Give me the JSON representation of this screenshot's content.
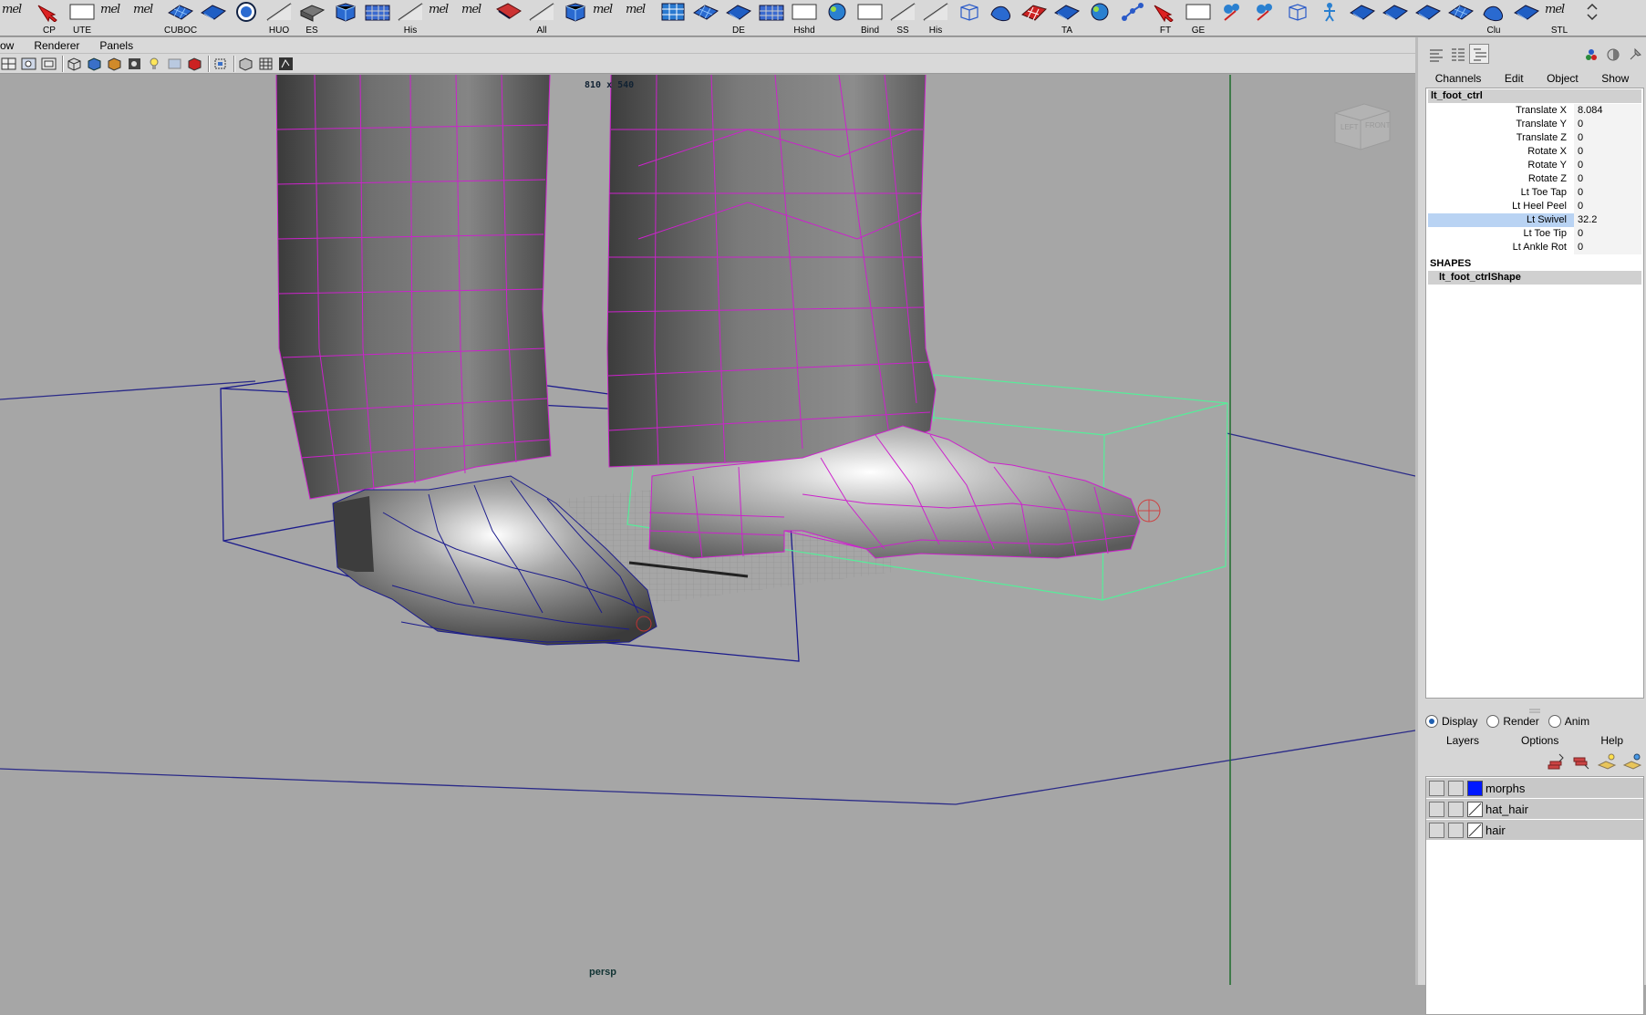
{
  "shelf": {
    "buttons": [
      {
        "label": "",
        "icon": "mel-icon",
        "mel": "mel"
      },
      {
        "label": "CP",
        "icon": "red-arrow-icon"
      },
      {
        "label": "UTE",
        "icon": "blank-icon"
      },
      {
        "label": "",
        "icon": "mel-icon",
        "mel": "mel"
      },
      {
        "label": "",
        "icon": "mel-icon",
        "mel": "mel"
      },
      {
        "label": "CUBOC",
        "icon": "blue-grid-icon"
      },
      {
        "label": "",
        "icon": "blue-plane-icon"
      },
      {
        "label": "",
        "icon": "circle-icon"
      },
      {
        "label": "HUO",
        "icon": "diagonal-icon"
      },
      {
        "label": "ES",
        "icon": "slab-icon"
      },
      {
        "label": "",
        "icon": "blue-cube-icon"
      },
      {
        "label": "",
        "icon": "mesh-icon"
      },
      {
        "label": "His",
        "icon": "diagonal-icon"
      },
      {
        "label": "",
        "icon": "mel-icon",
        "mel": "mel"
      },
      {
        "label": "",
        "icon": "mel-icon",
        "mel": "mel"
      },
      {
        "label": "",
        "icon": "red-slab-icon"
      },
      {
        "label": "All",
        "icon": "diagonal-icon"
      },
      {
        "label": "",
        "icon": "blue-cube-icon"
      },
      {
        "label": "",
        "icon": "mel-icon",
        "mel": "mel"
      },
      {
        "label": "",
        "icon": "mel-icon",
        "mel": "mel"
      },
      {
        "label": "",
        "icon": "grid-icon"
      },
      {
        "label": "",
        "icon": "blue-grid-icon"
      },
      {
        "label": "DE",
        "icon": "blue-plane-icon"
      },
      {
        "label": "",
        "icon": "mesh-icon"
      },
      {
        "label": "Hshd",
        "icon": "blank-icon"
      },
      {
        "label": "",
        "icon": "sphere-icon"
      },
      {
        "label": "Bind",
        "icon": "blank-icon"
      },
      {
        "label": "SS",
        "icon": "diagonal-icon"
      },
      {
        "label": "His",
        "icon": "diagonal-icon"
      },
      {
        "label": "",
        "icon": "wire-cube-icon"
      },
      {
        "label": "",
        "icon": "blue-shape-icon"
      },
      {
        "label": "",
        "icon": "red-grid-icon"
      },
      {
        "label": "TA",
        "icon": "blue-plane-icon"
      },
      {
        "label": "",
        "icon": "sphere-icon"
      },
      {
        "label": "",
        "icon": "joint-icon"
      },
      {
        "label": "FT",
        "icon": "red-arrow-icon"
      },
      {
        "label": "GE",
        "icon": "blank-icon"
      },
      {
        "label": "",
        "icon": "paint-icon"
      },
      {
        "label": "",
        "icon": "paint-icon"
      },
      {
        "label": "",
        "icon": "wire-cube-icon"
      },
      {
        "label": "",
        "icon": "figure-icon"
      },
      {
        "label": "",
        "icon": "blue-plane-icon"
      },
      {
        "label": "",
        "icon": "blue-plane-icon"
      },
      {
        "label": "",
        "icon": "blue-plane-icon"
      },
      {
        "label": "",
        "icon": "blue-grid-icon"
      },
      {
        "label": "Clu",
        "icon": "blue-shape-icon"
      },
      {
        "label": "",
        "icon": "blue-plane-icon"
      },
      {
        "label": "STL",
        "icon": "mel-icon",
        "mel": "mel"
      },
      {
        "label": "",
        "icon": "scroll-arrows-icon"
      }
    ]
  },
  "panel_menu": [
    "ow",
    "Renderer",
    "Panels"
  ],
  "viewport": {
    "frame_counter": "810 x 540",
    "camera": "persp",
    "viewcube_left": "LEFT",
    "viewcube_front": "FRONT"
  },
  "channel_box": {
    "menu": [
      "Channels",
      "Edit",
      "Object",
      "Show"
    ],
    "object": "lt_foot_ctrl",
    "attributes": [
      {
        "name": "Translate X",
        "value": "8.084"
      },
      {
        "name": "Translate Y",
        "value": "0"
      },
      {
        "name": "Translate Z",
        "value": "0"
      },
      {
        "name": "Rotate X",
        "value": "0"
      },
      {
        "name": "Rotate Y",
        "value": "0"
      },
      {
        "name": "Rotate Z",
        "value": "0"
      },
      {
        "name": "Lt Toe Tap",
        "value": "0"
      },
      {
        "name": "Lt Heel Peel",
        "value": "0"
      },
      {
        "name": "Lt Swivel",
        "value": "32.2",
        "selected": true
      },
      {
        "name": "Lt Toe Tip",
        "value": "0"
      },
      {
        "name": "Lt Ankle Rot",
        "value": "0"
      }
    ],
    "shapes_header": "SHAPES",
    "shape_name": "lt_foot_ctrlShape"
  },
  "layer_editor": {
    "modes": [
      {
        "label": "Display",
        "selected": true
      },
      {
        "label": "Render",
        "selected": false
      },
      {
        "label": "Anim",
        "selected": false
      }
    ],
    "menu": [
      "Layers",
      "Options",
      "Help"
    ],
    "layers": [
      {
        "name": "morphs",
        "color": "#0018ff"
      },
      {
        "name": "hat_hair",
        "color": ""
      },
      {
        "name": "hair",
        "color": ""
      }
    ]
  },
  "colors": {
    "viewport_bg": "#a6a6a6",
    "wire_magenta": "#cc22cc",
    "wire_blue": "#1c1c8c",
    "ctrl_green": "#55ee99",
    "selection_blue": "#b9d3f3"
  }
}
